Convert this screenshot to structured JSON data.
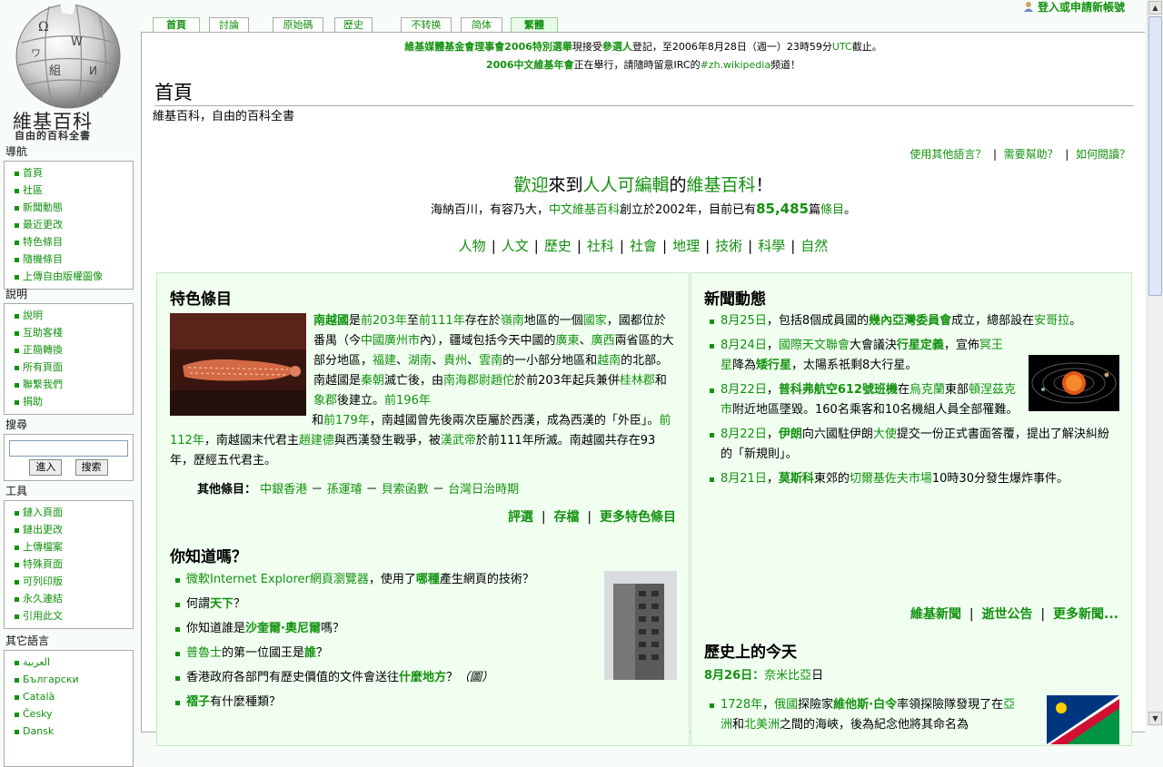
{
  "logo": {
    "title": "維基百科",
    "tagline": "自由的百科全書"
  },
  "user": {
    "login": "登入或申請新帳號"
  },
  "tabs": [
    {
      "label": "首頁",
      "selected": true
    },
    {
      "label": "討論"
    },
    {
      "label": "原始碼"
    },
    {
      "label": "歷史"
    },
    {
      "label": "不转换"
    },
    {
      "label": "简体"
    },
    {
      "label": "繁體",
      "selected": true
    }
  ],
  "nav": {
    "title": "導航",
    "items": [
      "首頁",
      "社區",
      "新聞動態",
      "最近更改",
      "特色條目",
      "隨機條目",
      "上傳自由版權圖像"
    ]
  },
  "help": {
    "title": "說明",
    "items": [
      "說明",
      "互助客棧",
      "正簡轉換",
      "所有頁面",
      "聯繫我們",
      "捐助"
    ]
  },
  "search": {
    "title": "搜尋",
    "go": "進入",
    "search": "搜索"
  },
  "tools": {
    "title": "工具",
    "items": [
      "鏈入頁面",
      "鏈出更改",
      "上傳檔案",
      "特殊頁面",
      "可列印版",
      "永久連結",
      "引用此文"
    ]
  },
  "langs": {
    "title": "其它語言",
    "items": [
      "العربية",
      "Български",
      "Català",
      "Česky",
      "Dansk"
    ]
  },
  "notice": {
    "l1a": "維基媒體基金會理事會2006特別選舉",
    "l1b": "現接受",
    "l1c": "參選人",
    "l1d": "登記，至2006年8月28日（週一）23時59分",
    "l1e": "UTC",
    "l1f": "截止。",
    "l2a": "2006中文維基年會",
    "l2b": "正在舉行，請隨時留意IRC的",
    "l2c": "#zh.wikipedia",
    "l2d": "频道！"
  },
  "page": {
    "title": "首頁",
    "subtitle": "維基百科，自由的百科全書"
  },
  "helpbar": {
    "a": "使用其他語言？",
    "b": "需要幫助？",
    "c": "如何閱讀？"
  },
  "welcome": {
    "a": "歡迎",
    "b": "來到",
    "c": "人人可編輯",
    "d": "的",
    "e": "維基百科",
    "f": "！"
  },
  "intro": {
    "a": "海納百川，有容乃大，",
    "b": "中文維基百科",
    "c": "創立於2002年，目前已有",
    "count": "85,485",
    "d": "篇",
    "e": "條目",
    "f": "。"
  },
  "topics": [
    "人物",
    "人文",
    "歷史",
    "社科",
    "社會",
    "地理",
    "技術",
    "科學",
    "自然"
  ],
  "featured": {
    "title": "特色條目",
    "other_label": "其他條目：",
    "others": [
      "中銀香港",
      "孫運璿",
      "貝索函數",
      "台灣日治時期"
    ],
    "sep": "－",
    "links": [
      "評選",
      "存檔",
      "更多特色條目"
    ]
  },
  "dyk": {
    "title": "你知道嗎？",
    "i1a": "微軟Internet Explorer網頁瀏覽器",
    "i1b": "，使用了",
    "i1c": "哪種",
    "i1d": "產生網頁的技術？",
    "i2a": "何謂",
    "i2b": "天下",
    "i2c": "？",
    "i3a": "你知道誰是",
    "i3b": "沙奎爾·奧尼爾",
    "i3c": "嗎？",
    "i4a": "普魯士",
    "i4b": "的第一位國王是",
    "i4c": "誰",
    "i4d": "？",
    "i5a": "香港政府各部門有歷史價值的文件會送往",
    "i5b": "什麼地方",
    "i5c": "？",
    "i5d": "（圖）",
    "i6a": "褶子",
    "i6b": "有什麼種類？"
  },
  "news": {
    "title": "新聞動態",
    "links": [
      "維基新聞",
      "逝世公告",
      "更多新聞..."
    ]
  },
  "otd": {
    "title": "歷史上的今天",
    "date": "8月26日：",
    "saint": "奈米比亞",
    "saint_tail": "日",
    "item_a": "1728年",
    "item_b": "，",
    "item_c": "俄國",
    "item_d": "探險家",
    "item_e": "維他斯·白令",
    "item_f": "率領探險隊發現了在",
    "item_g": "亞洲",
    "item_h": "和",
    "item_i": "北美洲",
    "item_j": "之間的海峽，後為紀念他將其命名為"
  }
}
